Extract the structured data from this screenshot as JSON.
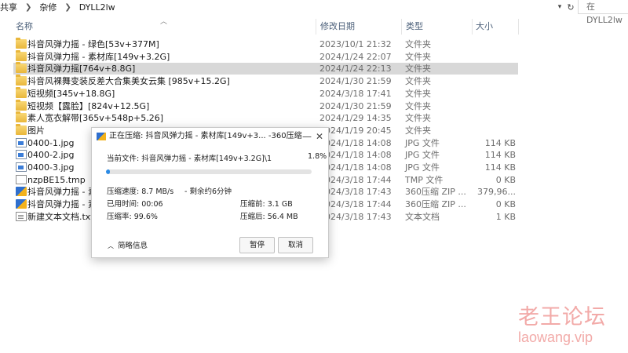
{
  "address_bar": {
    "crumbs": [
      "共享",
      "杂修",
      "DYLL2lw"
    ],
    "search_placeholder": "在 DYLL2lw"
  },
  "columns": {
    "name": "名称",
    "date": "修改日期",
    "type": "类型",
    "size": "大小"
  },
  "files": [
    {
      "name": "抖音风弹力摇 - 绿色[53v+377M]",
      "date": "2023/10/1 21:32",
      "type": "文件夹",
      "size": "",
      "icon": "folder-icon",
      "selected": false
    },
    {
      "name": "抖音风弹力摇 - 素材库[149v+3.2G]",
      "date": "2024/1/24 22:07",
      "type": "文件夹",
      "size": "",
      "icon": "folder-icon",
      "selected": false
    },
    {
      "name": "抖音风弹力摇[764v+8.8G]",
      "date": "2024/1/24 22:13",
      "type": "文件夹",
      "size": "",
      "icon": "folder-icon",
      "selected": true
    },
    {
      "name": "抖音风裸舞变装反差大合集美女云集 [985v+15.2G]",
      "date": "2024/1/30 21:59",
      "type": "文件夹",
      "size": "",
      "icon": "folder-icon",
      "selected": false
    },
    {
      "name": "短视频[345v+18.8G]",
      "date": "2024/3/18 17:41",
      "type": "文件夹",
      "size": "",
      "icon": "folder-icon",
      "selected": false
    },
    {
      "name": "短视频【露脸】[824v+12.5G]",
      "date": "2024/1/30 21:59",
      "type": "文件夹",
      "size": "",
      "icon": "folder-icon",
      "selected": false
    },
    {
      "name": "素人宽衣解带[365v+548p+5.26]",
      "date": "2024/1/29 14:35",
      "type": "文件夹",
      "size": "",
      "icon": "folder-icon",
      "selected": false
    },
    {
      "name": "图片",
      "date": "2024/1/19 20:45",
      "type": "文件夹",
      "size": "",
      "icon": "folder-icon",
      "selected": false
    },
    {
      "name": "0400-1.jpg",
      "date": "2024/1/18 14:08",
      "type": "JPG 文件",
      "size": "114 KB",
      "icon": "jpg-file-icon",
      "selected": false
    },
    {
      "name": "0400-2.jpg",
      "date": "2024/1/18 14:08",
      "type": "JPG 文件",
      "size": "114 KB",
      "icon": "jpg-file-icon",
      "selected": false
    },
    {
      "name": "0400-3.jpg",
      "date": "2024/1/18 14:08",
      "type": "JPG 文件",
      "size": "114 KB",
      "icon": "jpg-file-icon",
      "selected": false
    },
    {
      "name": "nzpBE15.tmp",
      "date": "2024/3/18 17:44",
      "type": "TMP 文件",
      "size": "0 KB",
      "icon": "tmp-file-icon",
      "selected": false
    },
    {
      "name": "抖音风弹力摇 - 素材库[149v+3.2G]",
      "date": "2024/3/18 17:43",
      "type": "360压缩 ZIP ...",
      "size": "379,96...",
      "icon": "zip-file-icon",
      "selected": false
    },
    {
      "name": "抖音风弹力摇 - 素材库[149v+3.2G]",
      "date": "2024/3/18 17:44",
      "type": "360压缩 ZIP ...",
      "size": "0 KB",
      "icon": "zip-file-icon",
      "selected": false
    },
    {
      "name": "新建文本文档.txt",
      "date": "2024/3/18 17:43",
      "type": "文本文档",
      "size": "1 KB",
      "icon": "text-file-icon",
      "selected": false
    }
  ],
  "dialog": {
    "title": "正在压缩: 抖音风弹力摇 - 素材库[149v+3... -360压缩",
    "current_file": "当前文件: 抖音风弹力摇 - 素材库[149v+3.2G]\\1",
    "percent": "1.8%",
    "progress_fraction": 0.018,
    "speed": "压缩速度: 8.7 MB/s",
    "remaining": "- 剩余约6分钟",
    "elapsed": "已用时间: 00:06",
    "before": "压缩前:  3.1 GB",
    "ratio": "压缩率:   99.6%",
    "after": "压缩后: 56.4 MB",
    "details_label": "简略信息",
    "pause_label": "暂停",
    "cancel_label": "取消"
  },
  "watermark": {
    "line1": "老王论坛",
    "line2": "laowang.vip"
  }
}
